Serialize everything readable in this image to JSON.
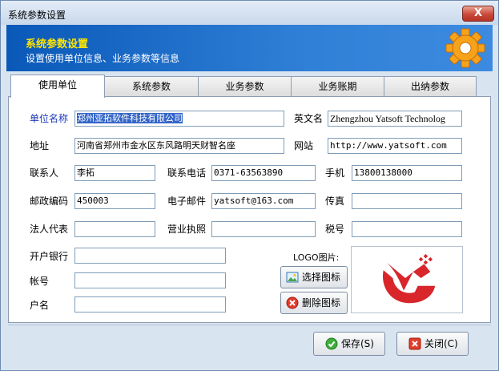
{
  "window": {
    "title": "系统参数设置",
    "close_glyph": "X"
  },
  "banner": {
    "title": "系统参数设置",
    "subtitle": "设置使用单位信息、业务参数等信息",
    "icon": "gear-icon"
  },
  "tabs": [
    {
      "label": "使用单位",
      "active": true
    },
    {
      "label": "系统参数",
      "active": false
    },
    {
      "label": "业务参数",
      "active": false
    },
    {
      "label": "业务账期",
      "active": false
    },
    {
      "label": "出纳参数",
      "active": false
    }
  ],
  "form": {
    "company_name": {
      "label": "单位名称",
      "value": "郑州亚拓软件科技有限公司"
    },
    "english_name": {
      "label": "英文名",
      "value": "Zhengzhou Yatsoft Technolog"
    },
    "address": {
      "label": "地址",
      "value": "河南省郑州市金水区东风路明天财智名座"
    },
    "website": {
      "label": "网站",
      "value": "http://www.yatsoft.com"
    },
    "contact": {
      "label": "联系人",
      "value": "李拓"
    },
    "phone": {
      "label": "联系电话",
      "value": "0371-63563890"
    },
    "mobile": {
      "label": "手机",
      "value": "13800138000"
    },
    "postcode": {
      "label": "邮政编码",
      "value": "450003"
    },
    "email": {
      "label": "电子邮件",
      "value": "yatsoft@163.com"
    },
    "fax": {
      "label": "传真",
      "value": ""
    },
    "legal_rep": {
      "label": "法人代表",
      "value": ""
    },
    "license": {
      "label": "营业执照",
      "value": ""
    },
    "tax_no": {
      "label": "税号",
      "value": ""
    },
    "bank": {
      "label": "开户银行",
      "value": ""
    },
    "account": {
      "label": "帐号",
      "value": ""
    },
    "account_name": {
      "label": "户名",
      "value": ""
    },
    "logo_label": "LOGO图片:",
    "choose_icon": "选择图标",
    "delete_icon": "删除图标"
  },
  "footer": {
    "save": "保存(S)",
    "close": "关闭(C)"
  },
  "colors": {
    "banner_title": "#ffe600",
    "label_highlight": "#1a38b8",
    "selection": "#3264c8"
  }
}
